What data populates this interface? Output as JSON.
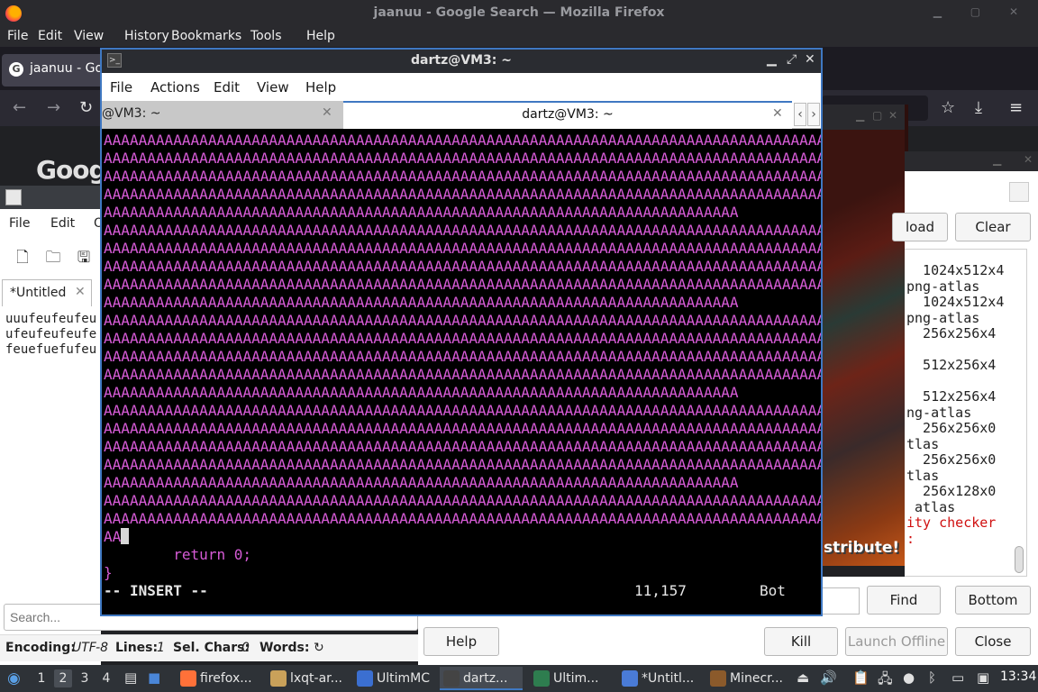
{
  "firefox": {
    "window_title": "jaanuu - Google Search — Mozilla Firefox",
    "menu": [
      "File",
      "Edit",
      "View",
      "History",
      "Bookmarks",
      "Tools",
      "Help"
    ],
    "tab_label": "jaanuu - Go",
    "google_logo": "Goog"
  },
  "terminal": {
    "title": "dartz@VM3: ~",
    "menu": [
      "File",
      "Actions",
      "Edit",
      "View",
      "Help"
    ],
    "tabs": [
      {
        "label": "@VM3: ~",
        "active": false
      },
      {
        "label": "dartz@VM3: ~",
        "active": true
      }
    ],
    "lines": [
      "AAAAAAAAAAAAAAAAAAAAAAAAAAAAAAAAAAAAAAAAAAAAAAAAAAAAAAAAAAAAAAAAAAAAAAAAAAAAAAAAAAAA",
      "AAAAAAAAAAAAAAAAAAAAAAAAAAAAAAAAAAAAAAAAAAAAAAAAAAAAAAAAAAAAAAAAAAAAAAAAAAAAAAAAAAAA",
      "AAAAAAAAAAAAAAAAAAAAAAAAAAAAAAAAAAAAAAAAAAAAAAAAAAAAAAAAAAAAAAAAAAAAAAAAAAAAAAAAAAAA",
      "AAAAAAAAAAAAAAAAAAAAAAAAAAAAAAAAAAAAAAAAAAAAAAAAAAAAAAAAAAAAAAAAAAAAAAAAAAAAAAAAAAAA",
      "AAAAAAAAAAAAAAAAAAAAAAAAAAAAAAAAAAAAAAAAAAAAAAAAAAAAAAAAAAAAAAAAAAAAAAAAA",
      "AAAAAAAAAAAAAAAAAAAAAAAAAAAAAAAAAAAAAAAAAAAAAAAAAAAAAAAAAAAAAAAAAAAAAAAAAAAAAAAAAAAA",
      "AAAAAAAAAAAAAAAAAAAAAAAAAAAAAAAAAAAAAAAAAAAAAAAAAAAAAAAAAAAAAAAAAAAAAAAAAAAAAAAAAAAA",
      "AAAAAAAAAAAAAAAAAAAAAAAAAAAAAAAAAAAAAAAAAAAAAAAAAAAAAAAAAAAAAAAAAAAAAAAAAAAAAAAAAAAA",
      "AAAAAAAAAAAAAAAAAAAAAAAAAAAAAAAAAAAAAAAAAAAAAAAAAAAAAAAAAAAAAAAAAAAAAAAAAAAAAAAAAAAA",
      "AAAAAAAAAAAAAAAAAAAAAAAAAAAAAAAAAAAAAAAAAAAAAAAAAAAAAAAAAAAAAAAAAAAAAAAAA",
      "AAAAAAAAAAAAAAAAAAAAAAAAAAAAAAAAAAAAAAAAAAAAAAAAAAAAAAAAAAAAAAAAAAAAAAAAAAAAAAAAAAAA",
      "AAAAAAAAAAAAAAAAAAAAAAAAAAAAAAAAAAAAAAAAAAAAAAAAAAAAAAAAAAAAAAAAAAAAAAAAAAAAAAAAAAAA",
      "AAAAAAAAAAAAAAAAAAAAAAAAAAAAAAAAAAAAAAAAAAAAAAAAAAAAAAAAAAAAAAAAAAAAAAAAAAAAAAAAAAAA",
      "AAAAAAAAAAAAAAAAAAAAAAAAAAAAAAAAAAAAAAAAAAAAAAAAAAAAAAAAAAAAAAAAAAAAAAAAAAAAAAAAAAAA",
      "AAAAAAAAAAAAAAAAAAAAAAAAAAAAAAAAAAAAAAAAAAAAAAAAAAAAAAAAAAAAAAAAAAAAAAAAA",
      "AAAAAAAAAAAAAAAAAAAAAAAAAAAAAAAAAAAAAAAAAAAAAAAAAAAAAAAAAAAAAAAAAAAAAAAAAAAAAAAAAAAA",
      "AAAAAAAAAAAAAAAAAAAAAAAAAAAAAAAAAAAAAAAAAAAAAAAAAAAAAAAAAAAAAAAAAAAAAAAAAAAAAAAAAAAA",
      "AAAAAAAAAAAAAAAAAAAAAAAAAAAAAAAAAAAAAAAAAAAAAAAAAAAAAAAAAAAAAAAAAAAAAAAAAAAAAAAAAAAA",
      "AAAAAAAAAAAAAAAAAAAAAAAAAAAAAAAAAAAAAAAAAAAAAAAAAAAAAAAAAAAAAAAAAAAAAAAAAAAAAAAAAAAA",
      "AAAAAAAAAAAAAAAAAAAAAAAAAAAAAAAAAAAAAAAAAAAAAAAAAAAAAAAAAAAAAAAAAAAAAAAAA",
      "AAAAAAAAAAAAAAAAAAAAAAAAAAAAAAAAAAAAAAAAAAAAAAAAAAAAAAAAAAAAAAAAAAAAAAAAAAAAAAAAAAAA",
      "AAAAAAAAAAAAAAAAAAAAAAAAAAAAAAAAAAAAAAAAAAAAAAAAAAAAAAAAAAAAAAAAAAAAAAAAAAAAAAAAAAAA",
      "AA"
    ],
    "code_line": "        return 0;",
    "brace_line": "}",
    "mode_text": "-- INSERT --",
    "position": "11,157",
    "scroll_pos": "Bot"
  },
  "featherpad": {
    "menu": [
      "File",
      "Edit",
      "O"
    ],
    "tab_label": "*Untitled",
    "text_lines": [
      "uuufeufeufeu",
      "ufeufeufeufe",
      "feuefuefufeu"
    ],
    "search_placeholder": "Search...",
    "status": {
      "encoding_label": "Encoding:",
      "encoding_value": "UTF-8",
      "lines_label": "Lines:",
      "lines_value": "1",
      "sel_label": "Sel. Chars:",
      "sel_value": "0",
      "words_label": "Words:"
    }
  },
  "minecraft": {
    "footer_text": "stribute!"
  },
  "ultimmc": {
    "buttons_top": [
      "load",
      "Clear"
    ],
    "log_lines": [
      {
        "text": "  1024x512x4",
        "color": "normal"
      },
      {
        "text": "png-atlas",
        "color": "normal"
      },
      {
        "text": "  1024x512x4",
        "color": "normal"
      },
      {
        "text": "png-atlas",
        "color": "normal"
      },
      {
        "text": "  256x256x4",
        "color": "normal"
      },
      {
        "text": "",
        "color": "normal"
      },
      {
        "text": "  512x256x4",
        "color": "normal"
      },
      {
        "text": "",
        "color": "normal"
      },
      {
        "text": "  512x256x4",
        "color": "normal"
      },
      {
        "text": "ng-atlas",
        "color": "normal"
      },
      {
        "text": "  256x256x0",
        "color": "normal"
      },
      {
        "text": "tlas",
        "color": "normal"
      },
      {
        "text": "  256x256x0",
        "color": "normal"
      },
      {
        "text": "tlas",
        "color": "normal"
      },
      {
        "text": "  256x128x0",
        "color": "normal"
      },
      {
        "text": " atlas",
        "color": "normal"
      },
      {
        "text": "ity checker",
        "color": "red"
      },
      {
        "text": ":",
        "color": "red"
      }
    ],
    "find_label": "Find",
    "bottom_label": "Bottom",
    "help_label": "Help",
    "kill_label": "Kill",
    "launch_offline_label": "Launch Offline",
    "close_label": "Close"
  },
  "taskbar": {
    "workspaces": [
      "1",
      "2",
      "3",
      "4"
    ],
    "tasks": [
      {
        "label": "firefox...",
        "color": "#ff7139"
      },
      {
        "label": "lxqt-ar...",
        "color": "#c9a15a"
      },
      {
        "label": "UltimMC",
        "color": "#3b6fd1"
      },
      {
        "label": "dartz...",
        "color": "#444444"
      },
      {
        "label": "Ultim...",
        "color": "#2e7d4f"
      },
      {
        "label": "*Untitl...",
        "color": "#4a7bd6"
      },
      {
        "label": "Minecr...",
        "color": "#8b5a2b"
      }
    ],
    "clock": "13:34"
  }
}
